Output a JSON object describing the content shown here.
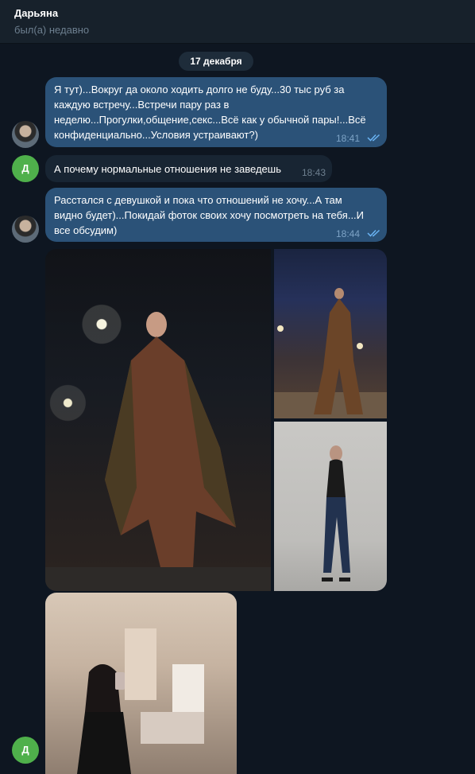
{
  "header": {
    "name": "Дарьяна",
    "status": "был(а) недавно"
  },
  "date_separator": "17 декабря",
  "messages": [
    {
      "direction": "out",
      "lines": [
        "Я тут)...Вокруг да около ходить долго не буду...30 тыс руб за",
        "каждую встречу...Встречи пару раз в",
        "неделю...Прогулки,общение,секс...Всё как у обычной пары!...Всё",
        "конфиденциально...Условия устраивают?)"
      ],
      "time": "18:41"
    },
    {
      "direction": "in",
      "lines": [
        "А почему нормальные отношения не заведешь"
      ],
      "time": "18:43"
    },
    {
      "direction": "out",
      "lines": [
        "Расстался с девушкой и пока что отношений не хочу...А там",
        "видно будет)...Покидай фоток своих хочу посмотреть на тебя...И",
        "все обсудим)"
      ],
      "time": "18:44"
    }
  ],
  "contact_avatar_letter": "Д",
  "colors": {
    "background": "#0e1621",
    "header": "#17212b",
    "outgoing_bubble": "#2b5278",
    "incoming_bubble": "#182533",
    "read_check": "#6ab3f3",
    "avatar_green": "#4fb04b"
  }
}
